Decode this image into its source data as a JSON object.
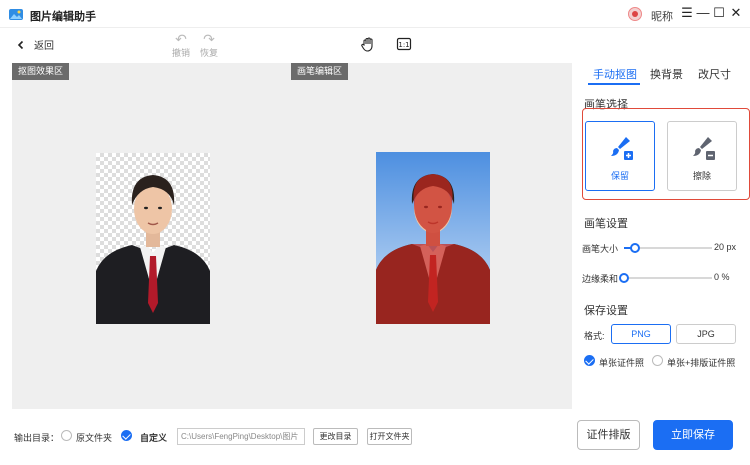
{
  "app": {
    "title": "图片编辑助手",
    "nickname": "昵称"
  },
  "toolbar": {
    "back": "返回",
    "undo": "撤销",
    "redo": "恢复"
  },
  "canvas": {
    "result_tag": "抠图效果区",
    "edit_tag": "画笔编辑区"
  },
  "panel": {
    "tabs": [
      "手动抠图",
      "换背景",
      "改尺寸"
    ],
    "brush_select_title": "画笔选择",
    "brush_keep": "保留",
    "brush_erase": "擦除",
    "brush_settings_title": "画笔设置",
    "brush_size_label": "画笔大小",
    "brush_size_value": "20 px",
    "brush_size_level": 0.13,
    "edge_soft_label": "边缘柔和",
    "edge_soft_value": "0 %",
    "edge_soft_level": 0,
    "save_settings_title": "保存设置",
    "format_label": "格式:",
    "format_options": [
      "PNG",
      "JPG"
    ],
    "single_photo": "单张证件照",
    "single_layout": "单张+排版证件照"
  },
  "bottom": {
    "output_label": "输出目录：",
    "original_folder": "原文件夹",
    "custom": "自定义",
    "path": "C:\\Users\\FengPing\\Desktop\\图片",
    "change_dir": "更改目录",
    "open_folder": "打开文件夹",
    "layout_btn": "证件排版",
    "save_btn": "立即保存"
  },
  "colors": {
    "accent": "#1b6ef3",
    "highlight_border": "#e04a3a",
    "mask_red": "#c8281e"
  }
}
